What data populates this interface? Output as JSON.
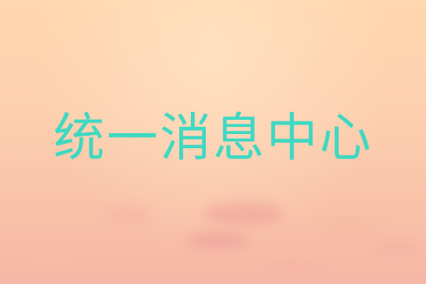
{
  "title": "统一消息中心",
  "colors": {
    "title_text": "#3fd8c2",
    "background_top": "#ffd6ad",
    "background_bottom": "#f6b7a6"
  }
}
